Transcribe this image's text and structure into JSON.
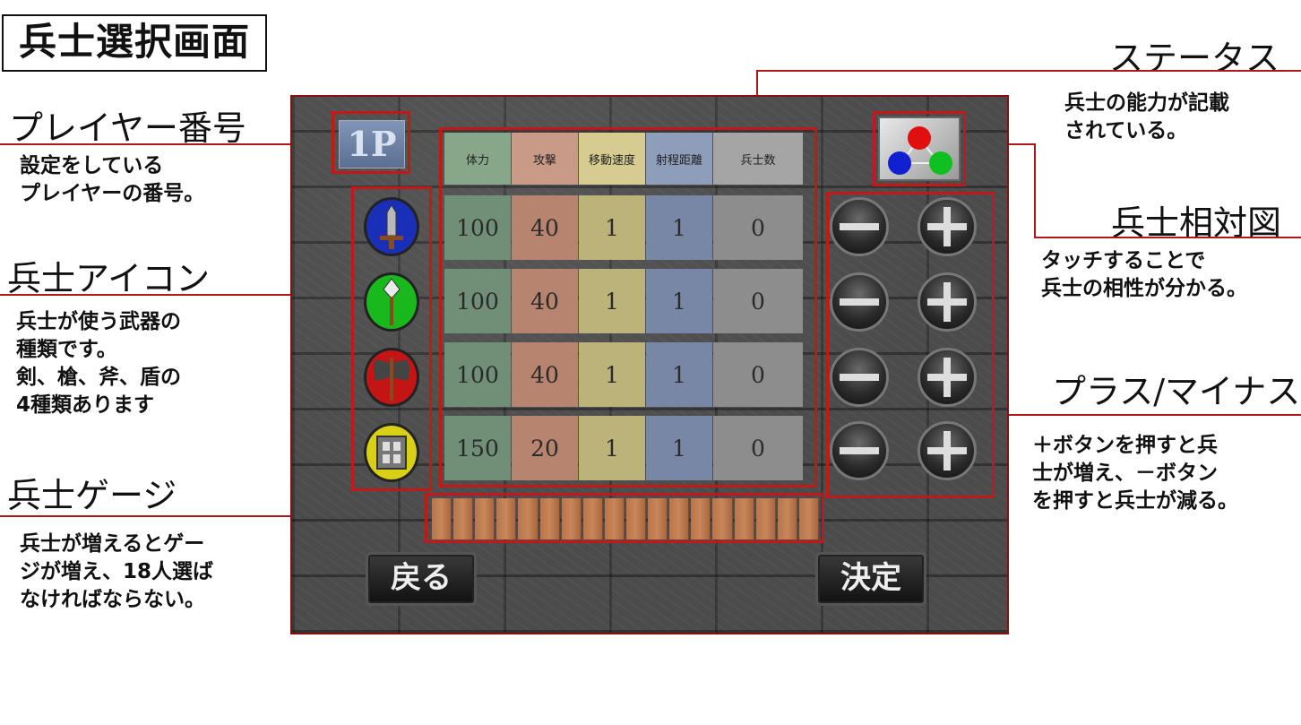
{
  "page_title": "兵士選択画面",
  "annotations": {
    "player_number": {
      "title": "プレイヤー番号",
      "desc": "設定をしている\nプレイヤーの番号。"
    },
    "unit_icon": {
      "title": "兵士アイコン",
      "desc": "兵士が使う武器の\n種類です。\n剣、槍、斧、盾の\n4種類あります"
    },
    "unit_gauge": {
      "title": "兵士ゲージ",
      "desc": "兵士が増えるとゲー\nジが増え、18人選ば\nなければならない。"
    },
    "status": {
      "title": "ステータス",
      "desc": "兵士の能力が記載\nされている。"
    },
    "affinity": {
      "title": "兵士相対図",
      "desc": "タッチすることで\n兵士の相性が分かる。"
    },
    "plus_minus": {
      "title": "プラス/マイナス",
      "desc": "＋ボタンを押すと兵\n士が増え、－ボタン\nを押すと兵士が減る。"
    }
  },
  "screen": {
    "player_badge": "1P",
    "stats": {
      "headers": [
        "体力",
        "攻撃",
        "移動速度",
        "射程距離",
        "兵士数"
      ],
      "rows": [
        {
          "unit": "sword",
          "values": [
            "100",
            "40",
            "1",
            "1",
            "0"
          ]
        },
        {
          "unit": "spear",
          "values": [
            "100",
            "40",
            "1",
            "1",
            "0"
          ]
        },
        {
          "unit": "axe",
          "values": [
            "100",
            "40",
            "1",
            "1",
            "0"
          ]
        },
        {
          "unit": "shield",
          "values": [
            "150",
            "20",
            "1",
            "1",
            "0"
          ]
        }
      ]
    },
    "unit_icons": [
      {
        "name": "sword-icon",
        "color": "#1a2fb8"
      },
      {
        "name": "spear-icon",
        "color": "#19b81c"
      },
      {
        "name": "axe-icon",
        "color": "#c41414"
      },
      {
        "name": "shield-icon",
        "color": "#d9cf14"
      }
    ],
    "gauge": {
      "segments": 18,
      "filled": 0
    },
    "back_label": "戻る",
    "confirm_label": "決定",
    "affinity_colors": [
      "#e01010",
      "#1020d0",
      "#10c020"
    ]
  },
  "colors": {
    "annotation_line": "#b01818",
    "highlight_box": "#c21818"
  }
}
